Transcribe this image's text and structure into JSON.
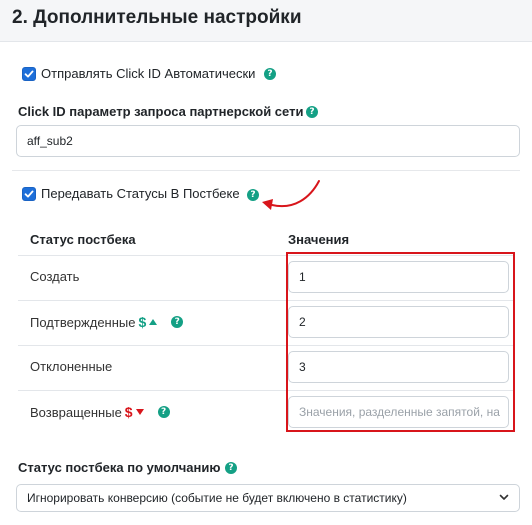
{
  "section": {
    "title": "2. Дополнительные настройки"
  },
  "click_id_auto": {
    "label": "Отправлять Click ID Автоматически",
    "checked": true
  },
  "click_id_param": {
    "label": "Click ID параметр запроса партнерской сети",
    "value": "aff_sub2"
  },
  "pass_statuses": {
    "label": "Передавать Статусы В Постбеке",
    "checked": true
  },
  "status_table": {
    "col_status": "Статус постбека",
    "col_values": "Значения",
    "rows": [
      {
        "label": "Создать",
        "value": "1",
        "placeholder": ""
      },
      {
        "label": "Подтвержденные",
        "value": "2",
        "placeholder": ""
      },
      {
        "label": "Отклоненные",
        "value": "3",
        "placeholder": ""
      },
      {
        "label": "Возвращенные",
        "value": "",
        "placeholder": "Значения, разделенные запятой, на"
      }
    ],
    "dollar_sign": "$"
  },
  "default_status": {
    "label": "Статус постбека по умолчанию",
    "selected": "Игнорировать конверсию (событие не будет включено в статистику)"
  },
  "icons": {
    "help": "question-circle-icon",
    "checkbox": "check-icon",
    "dollar_up": "dollar-up-icon",
    "dollar_down": "dollar-down-icon",
    "select": "chevron-down-icon",
    "annotation": "red-curved-arrow"
  },
  "colors": {
    "accent_blue": "#1e6fd9",
    "help_green": "#14a085",
    "up_green": "#14a085",
    "down_red": "#d8151b",
    "annotation_red": "#d8151b"
  }
}
